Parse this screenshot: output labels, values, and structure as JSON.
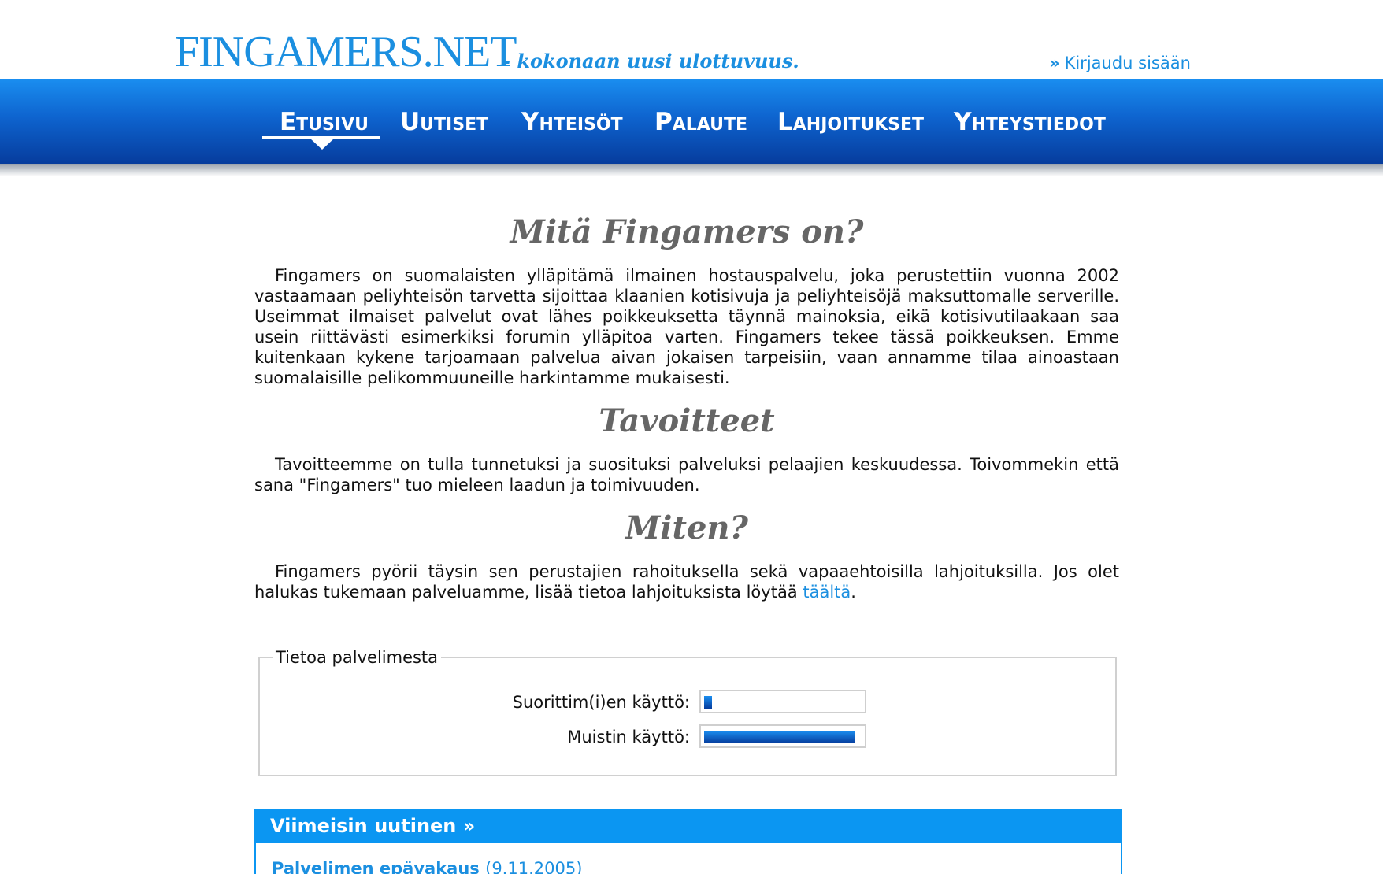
{
  "header": {
    "logo": "FINGAMERS.NET",
    "slogan": "- kokonaan uusi ulottuvuus.",
    "login_arrow": "»",
    "login_label": "Kirjaudu sisään"
  },
  "nav": {
    "active": "Etusivu",
    "items": [
      "Etusivu",
      "Uutiset",
      "Yhteisöt",
      "Palaute",
      "Lahjoitukset",
      "Yhteystiedot"
    ]
  },
  "sections": [
    {
      "title": "Mitä Fingamers on?",
      "text": "Fingamers on suomalaisten ylläpitämä ilmainen hostauspalvelu, joka perustettiin vuonna 2002 vastaamaan peliyhteisön tarvetta sijoittaa klaanien kotisivuja ja peliyhteisöjä maksuttomalle serverille. Useimmat ilmaiset palvelut ovat lähes poikkeuksetta täynnä mainoksia, eikä kotisivutilaakaan saa usein riittävästi esimerkiksi forumin ylläpitoa varten. Fingamers tekee tässä poikkeuksen. Emme kuitenkaan kykene tarjoamaan palvelua aivan jokaisen tarpeisiin, vaan annamme tilaa ainoastaan suomalaisille pelikommuuneille harkintamme mukaisesti."
    },
    {
      "title": "Tavoitteet",
      "text": "Tavoitteemme on tulla tunnetuksi ja suosituksi palveluksi pelaajien keskuudessa. Toivommekin että sana \"Fingamers\" tuo mieleen laadun ja toimivuuden."
    },
    {
      "title": "Miten?",
      "text": "Fingamers pyörii täysin sen perustajien rahoituksella sekä vapaaehtoisilla lahjoituksilla. Jos olet halukas tukemaan palveluamme, lisää tietoa lahjoituksista löytää",
      "link": "täältä",
      "after_link": "."
    }
  ],
  "server_info": {
    "legend": "Tietoa palvelimesta",
    "cpu_label": "Suorittim(i)en käyttö:",
    "cpu_usage": 0.05,
    "memory_label": "Muistin käyttö:",
    "memory_usage": 0.96
  },
  "latest_news": {
    "header": "Viimeisin uutinen »",
    "title": "Palvelimen epävakaus",
    "date": "(9.11.2005)"
  },
  "colors": {
    "accent": "#1b8fe0",
    "nav_top": "#1a8ef0",
    "nav_bottom": "#063c9d",
    "news_header": "#0b96f2"
  }
}
